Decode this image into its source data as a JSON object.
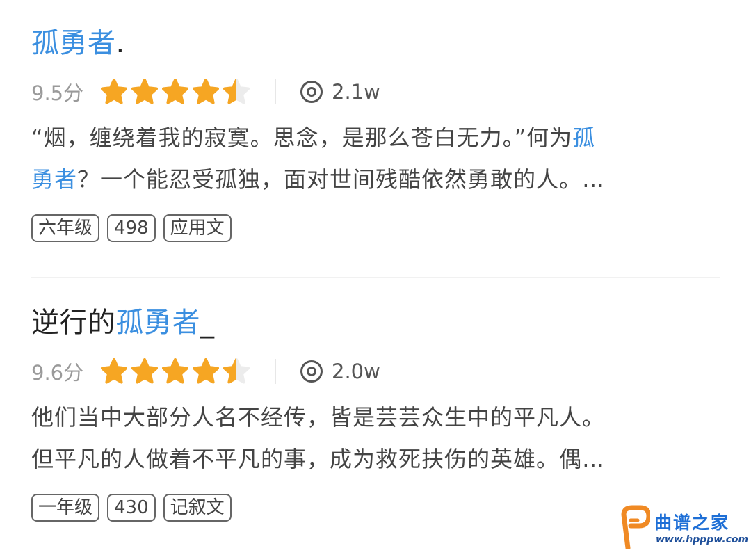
{
  "articles": [
    {
      "title_highlight": "孤勇者",
      "title_suffix": ".",
      "score": "9.5分",
      "rating": 4.5,
      "views": "2.1w",
      "desc_line1_pre": "“烟，缠绕着我的寂寞。思念，是那么苍白无力。”何为",
      "desc_line1_hl": "孤",
      "desc_line2_hl": "勇者",
      "desc_line2_post": "？一个能忍受孤独，面对世间残酷依然勇敢的人。…",
      "tags": [
        "六年级",
        "498",
        "应用文"
      ]
    },
    {
      "title_prefix": "逆行的",
      "title_highlight": "孤勇者",
      "title_suffix": "_",
      "score": "9.6分",
      "rating": 4.5,
      "views": "2.0w",
      "desc_line1": "他们当中大部分人名不经传，皆是芸芸众生中的平凡人。",
      "desc_line2": "但平凡的人做着不平凡的事，成为救死扶伤的英雄。偶…",
      "tags": [
        "一年级",
        "430",
        "记叙文"
      ]
    }
  ],
  "watermark": {
    "brand": "曲谱之家",
    "url": "www.hpppw.com"
  },
  "colors": {
    "highlight": "#3b8fe0",
    "star": "#f6a623",
    "star_empty": "#ececec"
  },
  "icons": {
    "rating": "star-icon",
    "views": "eye-icon"
  }
}
